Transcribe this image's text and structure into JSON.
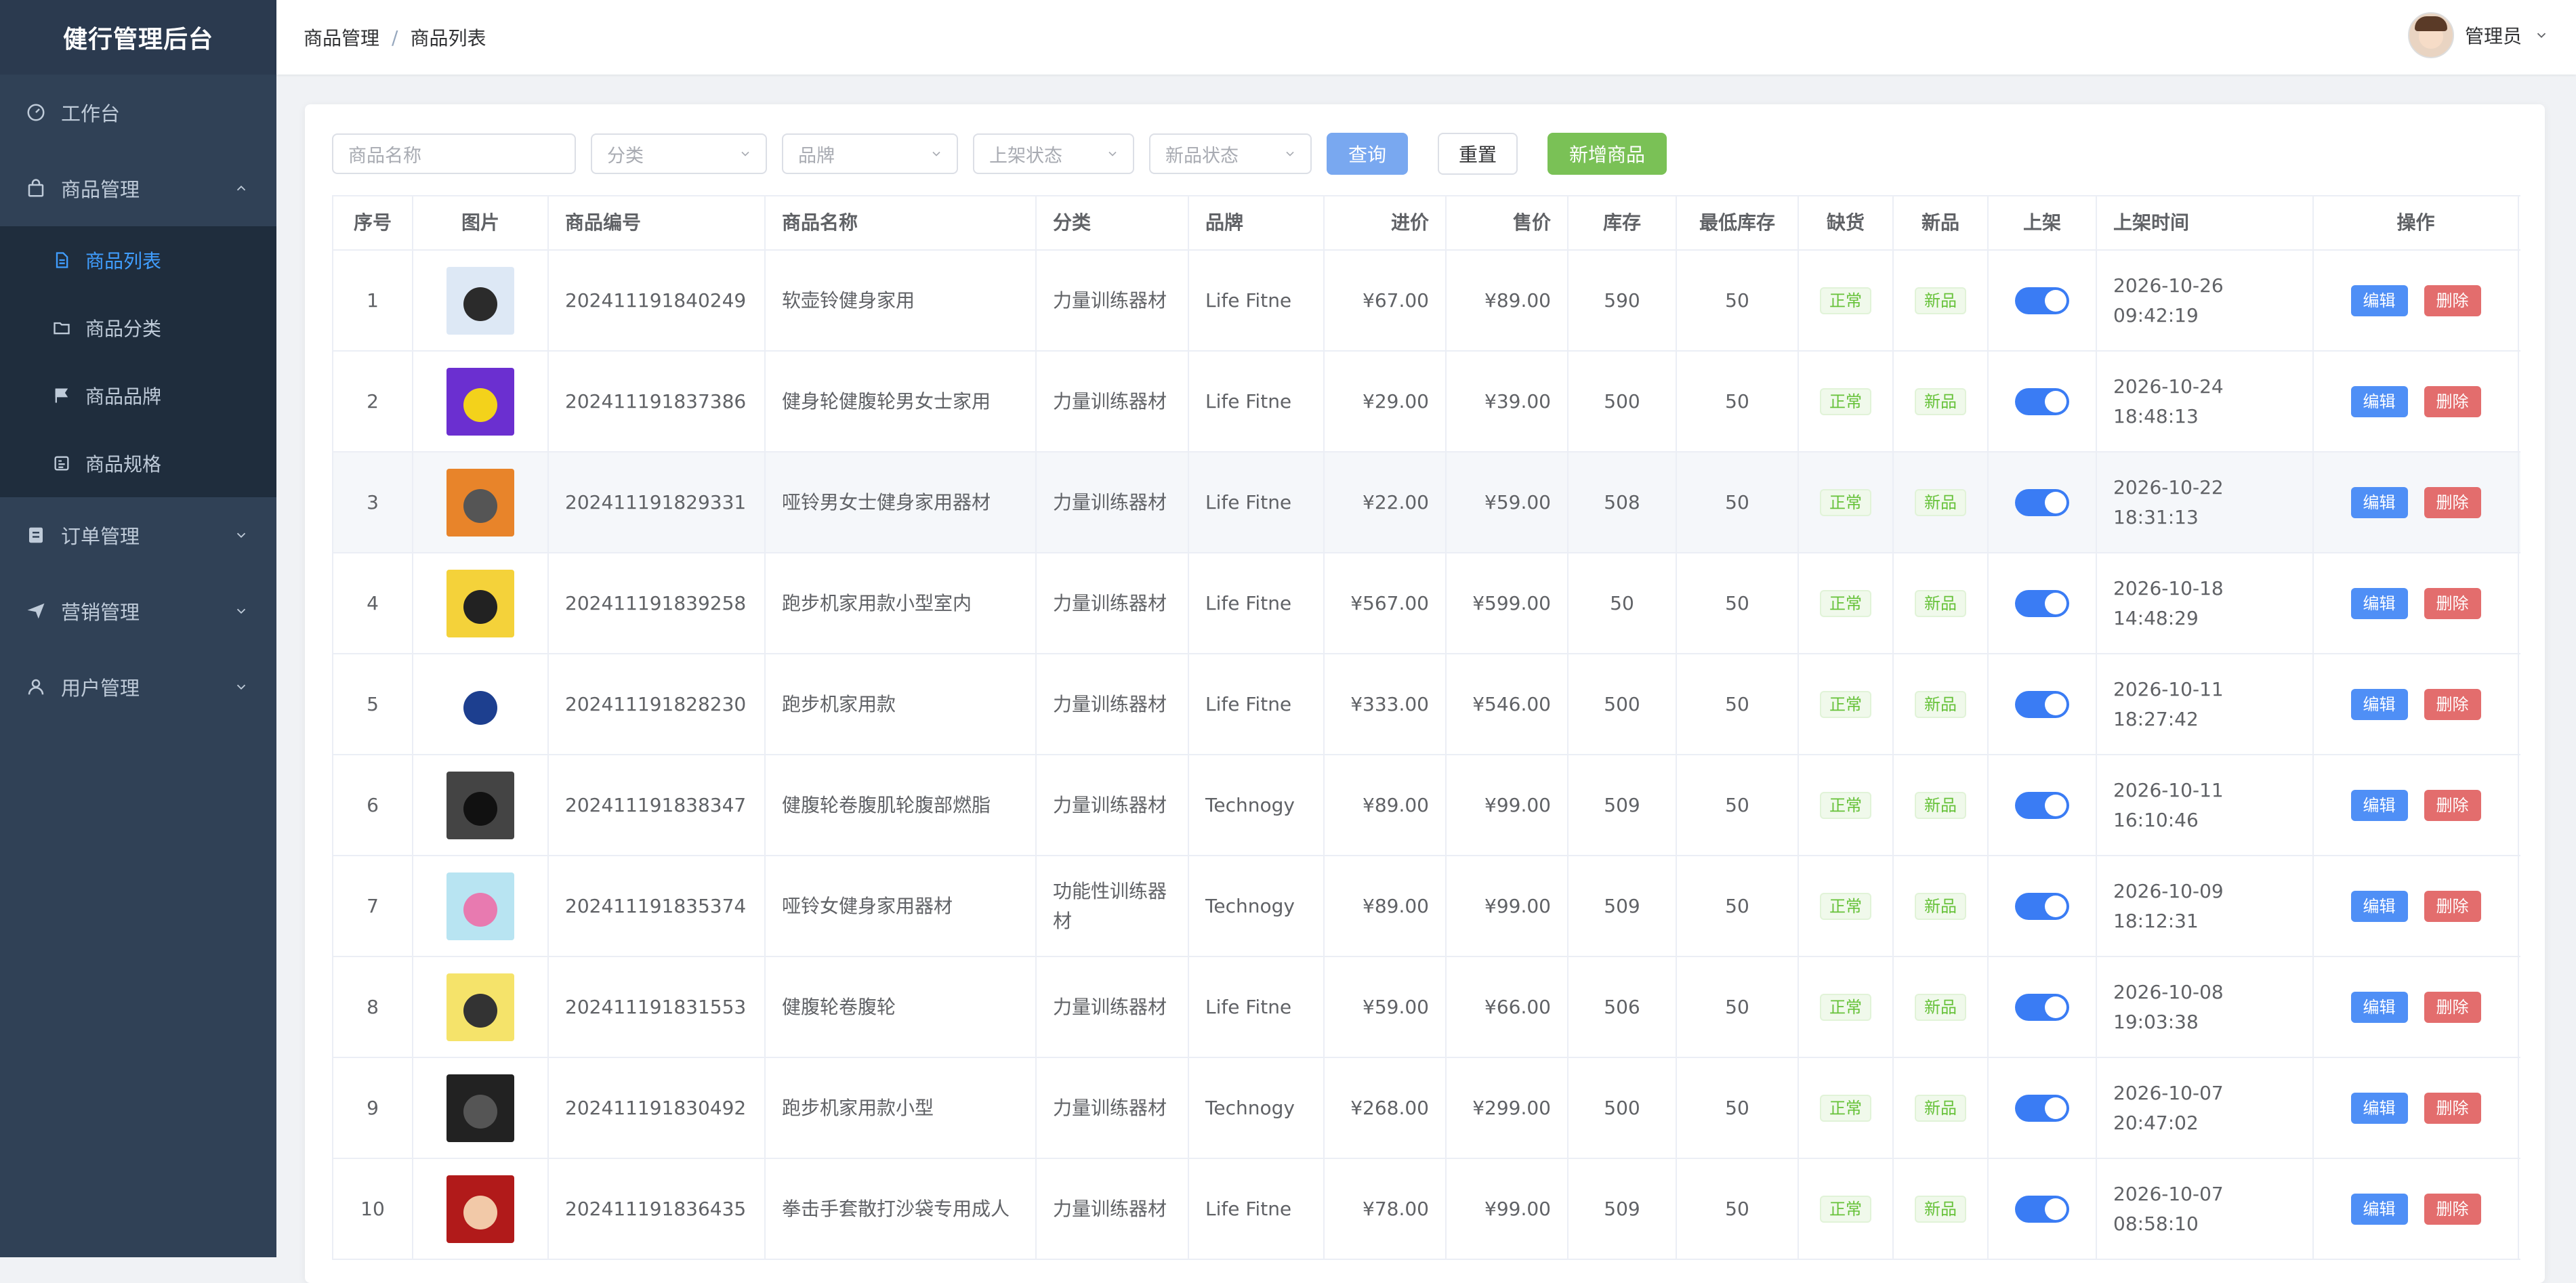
{
  "app": {
    "title": "健行管理后台"
  },
  "sidebar": {
    "items": [
      {
        "label": "工作台",
        "icon": "dashboard-icon"
      },
      {
        "label": "商品管理",
        "icon": "shopping-bag-icon",
        "expanded": true,
        "children": [
          {
            "label": "商品列表",
            "icon": "document-icon",
            "active": true
          },
          {
            "label": "商品分类",
            "icon": "folder-icon"
          },
          {
            "label": "商品品牌",
            "icon": "flag-icon"
          },
          {
            "label": "商品规格",
            "icon": "spec-icon"
          }
        ]
      },
      {
        "label": "订单管理",
        "icon": "order-icon"
      },
      {
        "label": "营销管理",
        "icon": "send-icon"
      },
      {
        "label": "用户管理",
        "icon": "user-icon"
      }
    ]
  },
  "header": {
    "breadcrumb": [
      "商品管理",
      "商品列表"
    ],
    "breadcrumb_sep": "/",
    "user": "管理员"
  },
  "toolbar": {
    "name_placeholder": "商品名称",
    "category_placeholder": "分类",
    "brand_placeholder": "品牌",
    "listing_placeholder": "上架状态",
    "new_placeholder": "新品状态",
    "query": "查询",
    "reset": "重置",
    "add": "新增商品"
  },
  "table": {
    "headers": [
      "序号",
      "图片",
      "商品编号",
      "商品名称",
      "分类",
      "品牌",
      "进价",
      "售价",
      "库存",
      "最低库存",
      "缺货",
      "新品",
      "上架",
      "上架时间",
      "操作"
    ],
    "edit_label": "编辑",
    "delete_label": "删除",
    "rows": [
      {
        "no": "1",
        "code": "202411191840249",
        "name": "软壶铃健身家用",
        "category": "力量训练器材",
        "brand": "Life Fitne",
        "cost": "¥67.00",
        "price": "¥89.00",
        "stock": "590",
        "min_stock": "50",
        "stock_status": "正常",
        "new": "新品",
        "listed": true,
        "time": "2026-10-26 09:42:19"
      },
      {
        "no": "2",
        "code": "202411191837386",
        "name": "健身轮健腹轮男女士家用",
        "category": "力量训练器材",
        "brand": "Life Fitne",
        "cost": "¥29.00",
        "price": "¥39.00",
        "stock": "500",
        "min_stock": "50",
        "stock_status": "正常",
        "new": "新品",
        "listed": true,
        "time": "2026-10-24 18:48:13"
      },
      {
        "no": "3",
        "code": "202411191829331",
        "name": "哑铃男女士健身家用器材",
        "category": "力量训练器材",
        "brand": "Life Fitne",
        "cost": "¥22.00",
        "price": "¥59.00",
        "stock": "508",
        "min_stock": "50",
        "stock_status": "正常",
        "new": "新品",
        "listed": true,
        "time": "2026-10-22 18:31:13"
      },
      {
        "no": "4",
        "code": "202411191839258",
        "name": "跑步机家用款小型室内",
        "category": "力量训练器材",
        "brand": "Life Fitne",
        "cost": "¥567.00",
        "price": "¥599.00",
        "stock": "50",
        "min_stock": "50",
        "stock_status": "正常",
        "new": "新品",
        "listed": true,
        "time": "2026-10-18 14:48:29"
      },
      {
        "no": "5",
        "code": "202411191828230",
        "name": "跑步机家用款",
        "category": "力量训练器材",
        "brand": "Life Fitne",
        "cost": "¥333.00",
        "price": "¥546.00",
        "stock": "500",
        "min_stock": "50",
        "stock_status": "正常",
        "new": "新品",
        "listed": true,
        "time": "2026-10-11 18:27:42"
      },
      {
        "no": "6",
        "code": "202411191838347",
        "name": "健腹轮卷腹肌轮腹部燃脂",
        "category": "力量训练器材",
        "brand": "Technogy",
        "cost": "¥89.00",
        "price": "¥99.00",
        "stock": "509",
        "min_stock": "50",
        "stock_status": "正常",
        "new": "新品",
        "listed": true,
        "time": "2026-10-11 16:10:46"
      },
      {
        "no": "7",
        "code": "202411191835374",
        "name": "哑铃女健身家用器材",
        "category": "功能性训练器材",
        "brand": "Technogy",
        "cost": "¥89.00",
        "price": "¥99.00",
        "stock": "509",
        "min_stock": "50",
        "stock_status": "正常",
        "new": "新品",
        "listed": true,
        "time": "2026-10-09 18:12:31"
      },
      {
        "no": "8",
        "code": "202411191831553",
        "name": "健腹轮卷腹轮",
        "category": "力量训练器材",
        "brand": "Life Fitne",
        "cost": "¥59.00",
        "price": "¥66.00",
        "stock": "506",
        "min_stock": "50",
        "stock_status": "正常",
        "new": "新品",
        "listed": true,
        "time": "2026-10-08 19:03:38"
      },
      {
        "no": "9",
        "code": "202411191830492",
        "name": "跑步机家用款小型",
        "category": "力量训练器材",
        "brand": "Technogy",
        "cost": "¥268.00",
        "price": "¥299.00",
        "stock": "500",
        "min_stock": "50",
        "stock_status": "正常",
        "new": "新品",
        "listed": true,
        "time": "2026-10-07 20:47:02"
      },
      {
        "no": "10",
        "code": "202411191836435",
        "name": "拳击手套散打沙袋专用成人",
        "category": "力量训练器材",
        "brand": "Life Fitne",
        "cost": "¥78.00",
        "price": "¥99.00",
        "stock": "509",
        "min_stock": "50",
        "stock_status": "正常",
        "new": "新品",
        "listed": true,
        "time": "2026-10-07 08:58:10"
      }
    ]
  },
  "colors": {
    "sidebar_bg": "#304156",
    "active": "#409eff",
    "primary_btn": "#79a8f0",
    "success_btn": "#7ac156",
    "danger": "#e36d6d",
    "switch_on": "#3a7cf4"
  }
}
